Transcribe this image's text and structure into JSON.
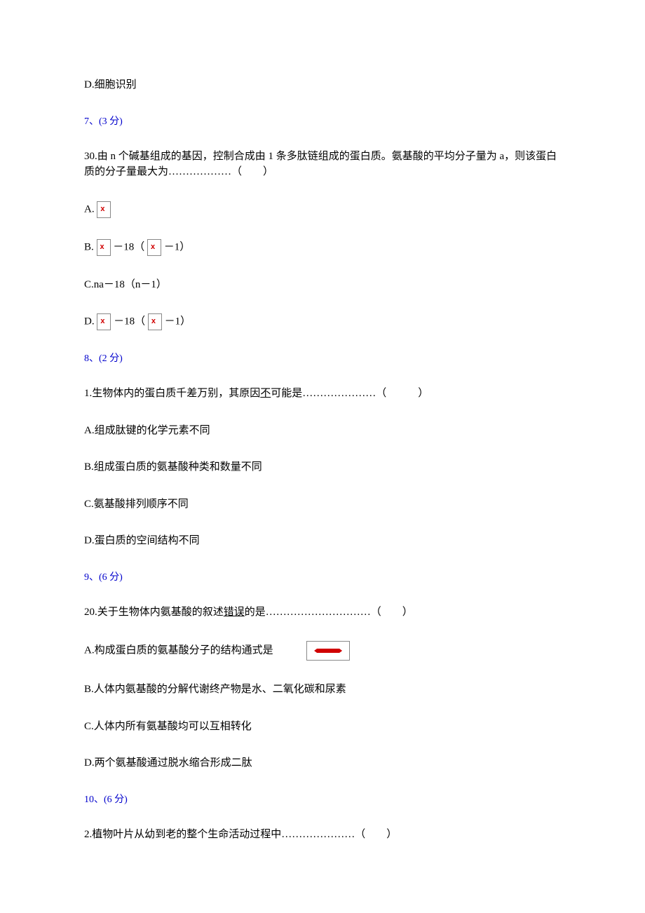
{
  "q6_option_d": "D.细胞识别",
  "q7_meta": "7、(3 分)",
  "q7_stem": "30.由 n 个碱基组成的基因，控制合成由 1 条多肽链组成的蛋白质。氨基酸的平均分子量为 a，则该蛋白质的分子量最大为………………（　　）",
  "q7_option_a_prefix": "A.",
  "q7_option_b_prefix": "B.",
  "q7_option_b_mid": "－18（",
  "q7_option_b_suffix": "－1）",
  "q7_option_c": "C.na－18（n－1）",
  "q7_option_d_prefix": "D.",
  "q7_option_d_mid": "－18（",
  "q7_option_d_suffix": "－1）",
  "q8_meta": "8、(2 分)",
  "q8_stem_pre": "1.生物体内的蛋白质千差万别，其原因",
  "q8_stem_underline": "不",
  "q8_stem_post": "可能是…………………（　　　）",
  "q8_option_a": "A.组成肽键的化学元素不同",
  "q8_option_b": "B.组成蛋白质的氨基酸种类和数量不同",
  "q8_option_c": "C.氨基酸排列顺序不同",
  "q8_option_d": "D.蛋白质的空间结构不同",
  "q9_meta": "9、(6 分)",
  "q9_stem_pre": "20.关于生物体内氨基酸的叙述",
  "q9_stem_underline": "错误",
  "q9_stem_post": "的是…………………………（　　）",
  "q9_option_a": "A.构成蛋白质的氨基酸分子的结构通式是",
  "q9_option_b": "B.人体内氨基酸的分解代谢终产物是水、二氧化碳和尿素",
  "q9_option_c": "C.人体内所有氨基酸均可以互相转化",
  "q9_option_d": "D.两个氨基酸通过脱水缩合形成二肽",
  "q10_meta": "10、(6 分)",
  "q10_stem": "2.植物叶片从幼到老的整个生命活动过程中…………………（　　）"
}
